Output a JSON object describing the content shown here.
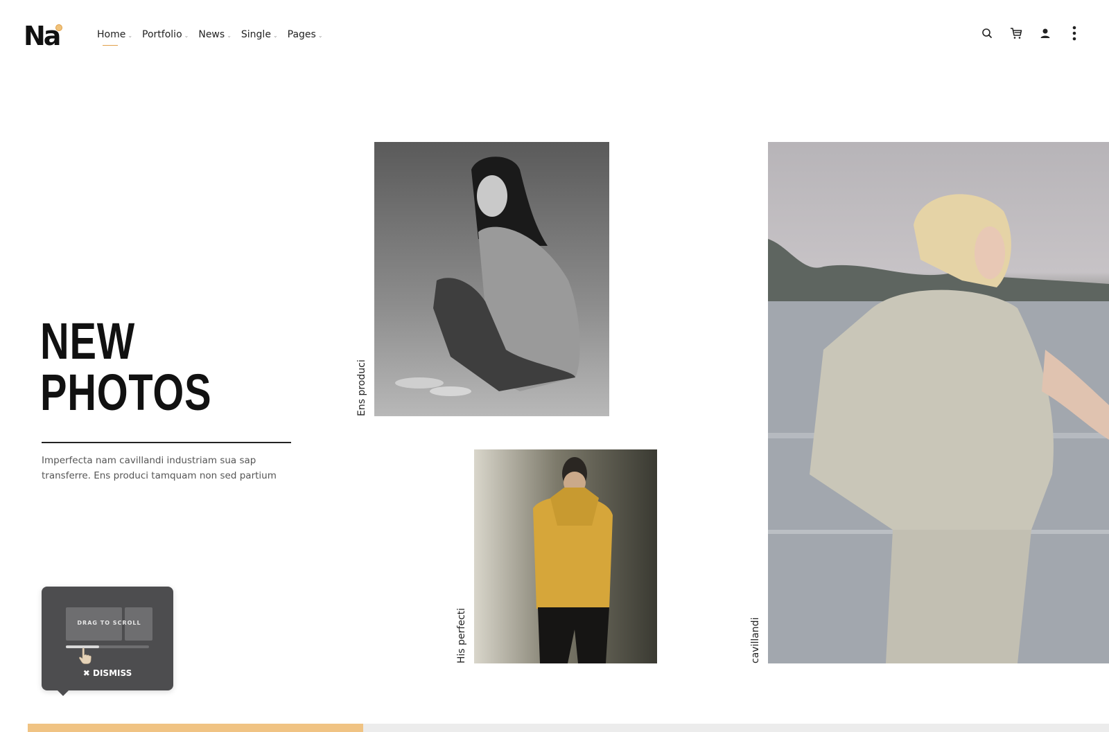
{
  "logo": {
    "text": "Na"
  },
  "nav": {
    "items": [
      {
        "label": "Home",
        "active": true
      },
      {
        "label": "Portfolio",
        "active": false
      },
      {
        "label": "News",
        "active": false
      },
      {
        "label": "Single",
        "active": false
      },
      {
        "label": "Pages",
        "active": false
      }
    ]
  },
  "header_icons": [
    "search-icon",
    "cart-icon",
    "user-icon",
    "more-vertical-icon"
  ],
  "hero": {
    "title_line1": "NEW",
    "title_line2": "PHOTOS",
    "intro": "Imperfecta nam cavillandi industriam sua sap transferre. Ens produci tamquam non sed partium"
  },
  "photos": [
    {
      "caption": "Ens produci",
      "subject": "black-and-white portrait of woman seated in sweater"
    },
    {
      "caption": "His perfecti",
      "subject": "man in yellow sweater covering face"
    },
    {
      "caption": "cavillandi",
      "subject": "blonde woman in beige jacket by the water"
    }
  ],
  "tooltip": {
    "label": "DRAG TO SCROLL",
    "dismiss": "✖ DISMISS",
    "progress": 0.4
  },
  "scroll_progress": 0.31,
  "colors": {
    "accent": "#f0c383",
    "tooltip_bg": "#4d4d4f",
    "text": "#222222"
  }
}
